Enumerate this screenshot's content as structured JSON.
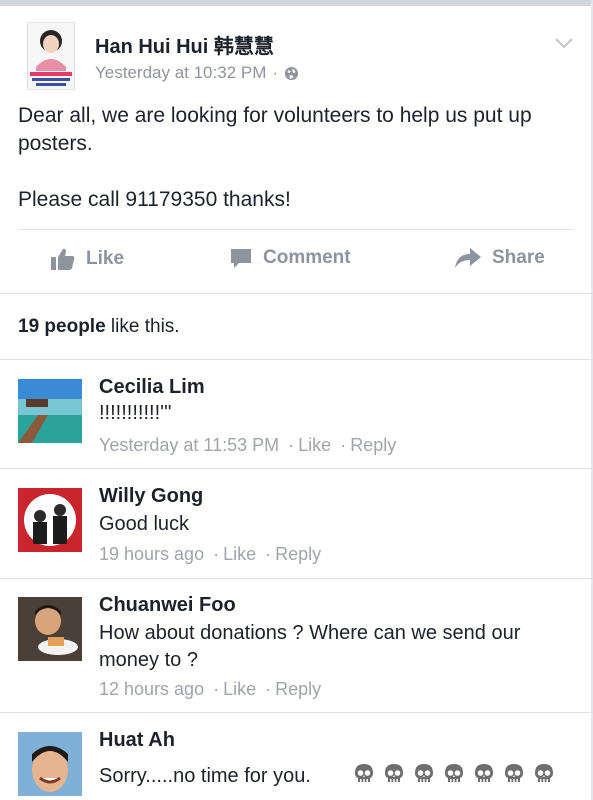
{
  "post": {
    "author": "Han Hui Hui 韩慧慧",
    "timestamp": "Yesterday at 10:32 PM",
    "dot": "·",
    "privacy_icon": "globe-icon",
    "text_line1": "Dear all, we are looking for volunteers to help us put up posters.",
    "text_line2": "Please call 91179350 thanks!"
  },
  "actions": {
    "like": "Like",
    "comment": "Comment",
    "share": "Share"
  },
  "likes": {
    "count": "19 people",
    "suffix": " like this."
  },
  "comments": [
    {
      "name": "Cecilia Lim",
      "text": "!!!!!!!!!!!'''",
      "time": "Yesterday at 11:53 PM",
      "like": "Like",
      "reply": "Reply"
    },
    {
      "name": "Willy Gong",
      "text": "Good luck",
      "time": "19 hours ago",
      "like": "Like",
      "reply": "Reply"
    },
    {
      "name": "Chuanwei Foo",
      "text": "How about donations ? Where can we send our money to ?",
      "time": "12 hours ago",
      "like": "Like",
      "reply": "Reply"
    },
    {
      "name": "Huat Ah",
      "text": "Sorry.....no time for you."
    }
  ],
  "colors": {
    "text": "#1d2129",
    "meta": "#90949c",
    "divider": "#e1e2e5"
  }
}
